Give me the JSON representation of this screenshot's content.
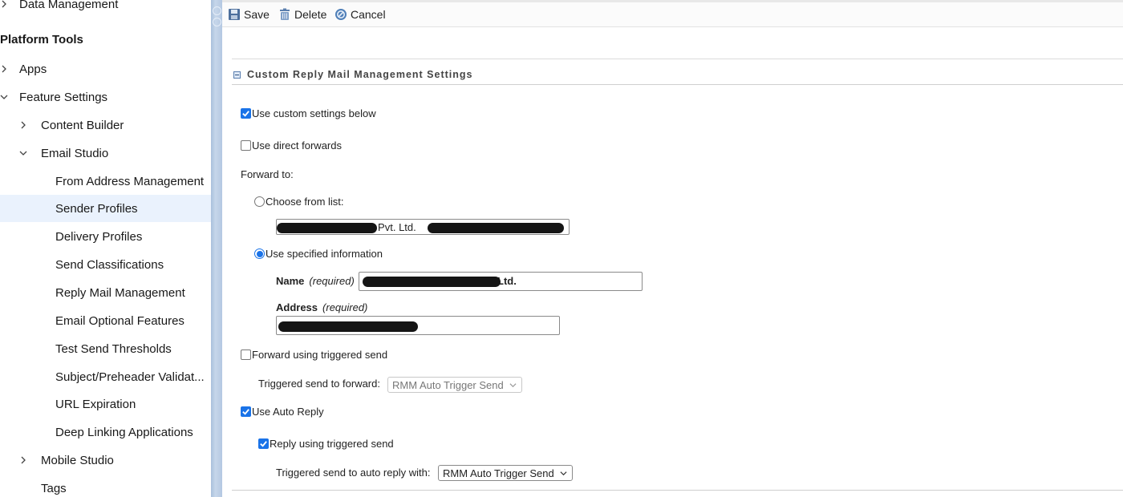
{
  "sidebar": {
    "top_item": "Data Management",
    "section_heading": "Platform Tools",
    "items": [
      {
        "label": "Apps"
      },
      {
        "label": "Feature Settings"
      },
      {
        "label": "Content Builder"
      },
      {
        "label": "Email Studio"
      },
      {
        "label": "From Address Management"
      },
      {
        "label": "Sender Profiles"
      },
      {
        "label": "Delivery Profiles"
      },
      {
        "label": "Send Classifications"
      },
      {
        "label": "Reply Mail Management"
      },
      {
        "label": "Email Optional Features"
      },
      {
        "label": "Test Send Thresholds"
      },
      {
        "label": "Subject/Preheader Validat..."
      },
      {
        "label": "URL Expiration"
      },
      {
        "label": "Deep Linking Applications"
      },
      {
        "label": "Mobile Studio"
      },
      {
        "label": "Tags"
      }
    ],
    "selected": "Sender Profiles"
  },
  "toolbar": {
    "save_label": "Save",
    "delete_label": "Delete",
    "cancel_label": "Cancel"
  },
  "section": {
    "title": "Custom Reply Mail Management Settings"
  },
  "form": {
    "use_custom_settings": {
      "label": "Use custom settings below",
      "checked": true
    },
    "use_direct_forwards": {
      "label": "Use direct forwards",
      "checked": false
    },
    "forward_to_label": "Forward to:",
    "choose_from_list": {
      "label": "Choose from list:",
      "selected": false,
      "value_visible": "ia) Pvt. Ltd."
    },
    "use_specified_information": {
      "label": "Use specified information",
      "selected": true
    },
    "name_label": "Name",
    "name_required": "(required)",
    "name_value_visible": "Ltd.",
    "address_label": "Address",
    "address_required": "(required)",
    "forward_using_triggered_send": {
      "label": "Forward using triggered send",
      "checked": false
    },
    "triggered_send_to_forward_label": "Triggered send to forward:",
    "triggered_send_to_forward_value": "RMM Auto Trigger Send",
    "use_auto_reply": {
      "label": "Use Auto Reply",
      "checked": true
    },
    "reply_using_triggered_send": {
      "label": "Reply using triggered send",
      "checked": true
    },
    "auto_reply_label": "Triggered send to auto reply with:",
    "auto_reply_value": "RMM Auto Trigger Send"
  },
  "colors": {
    "accent": "#1a73e8",
    "selected_row_bg": "#eaf2fd",
    "divider_strip": "#b4c8e2"
  }
}
